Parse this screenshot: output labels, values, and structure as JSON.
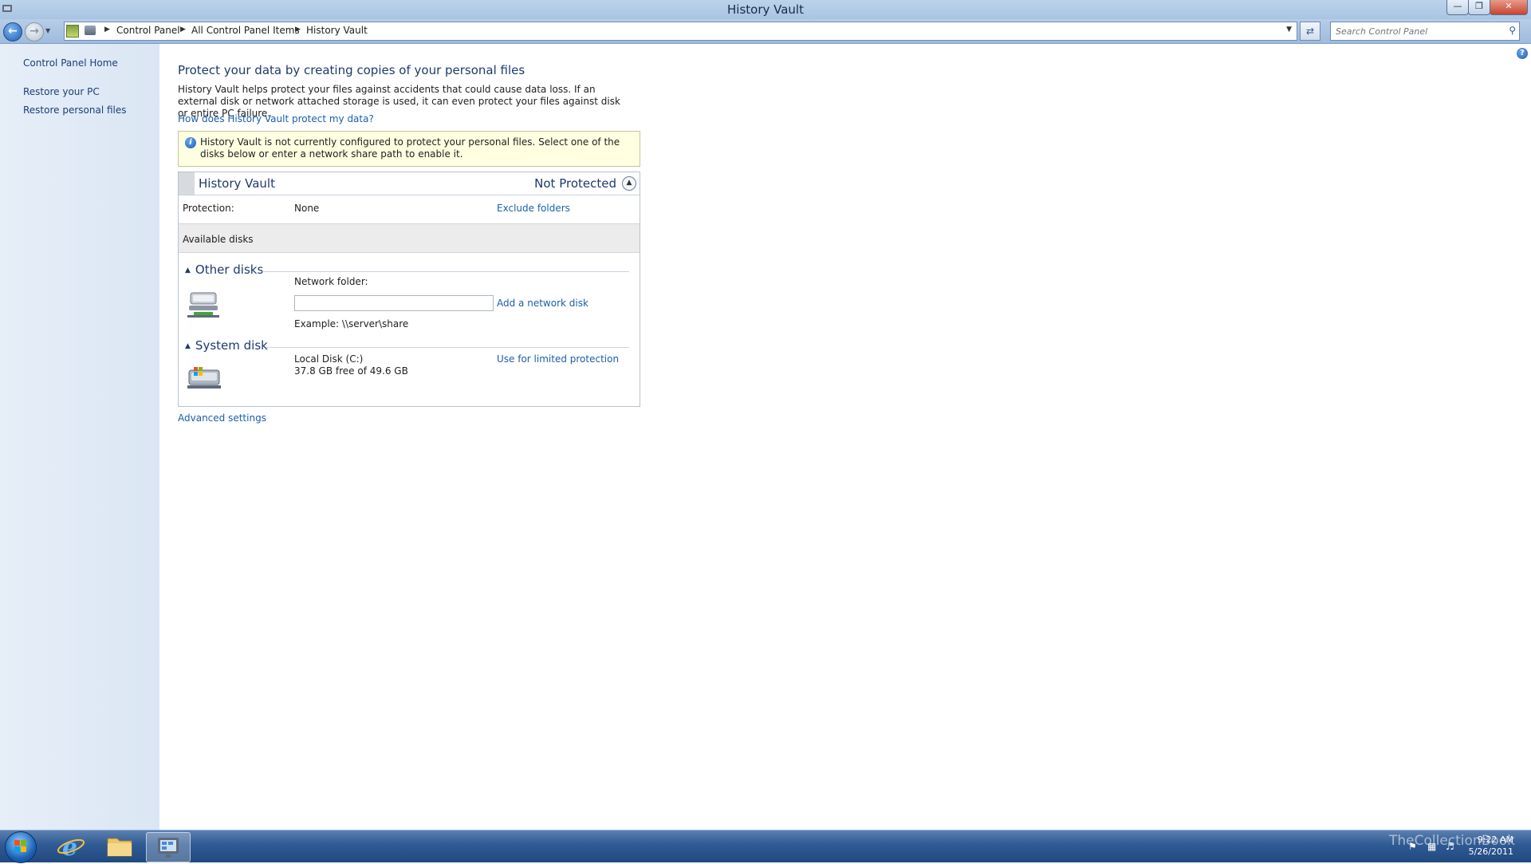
{
  "window": {
    "title": "History Vault"
  },
  "nav": {
    "breadcrumbs": [
      "Control Panel",
      "All Control Panel Items",
      "History Vault"
    ],
    "search_placeholder": "Search Control Panel"
  },
  "sidebar": {
    "items": [
      {
        "label": "Control Panel Home"
      },
      {
        "label": "Restore your PC"
      },
      {
        "label": "Restore personal files"
      }
    ]
  },
  "main": {
    "heading": "Protect your data by creating copies of your personal files",
    "description": "History Vault helps protect your files against accidents that could cause data loss. If an external disk or network attached storage is used, it can even protect your files against disk or entire PC failure.",
    "how_link": "How does History Vault protect my data?",
    "notice": "History Vault is not currently configured to protect your personal files. Select one of the disks below or enter a network share path to enable it.",
    "panel": {
      "name": "History Vault",
      "status": "Not Protected",
      "protection_label": "Protection:",
      "protection_value": "None",
      "exclude_link": "Exclude folders",
      "available_disks": "Available disks",
      "other_disks": {
        "title": "Other disks",
        "network_label": "Network folder:",
        "network_value": "",
        "add_link": "Add a network disk",
        "example": "Example: \\\\server\\share"
      },
      "system_disk": {
        "title": "System disk",
        "disk_name": "Local Disk (C:)",
        "disk_space": "37.8 GB free of 49.6 GB",
        "use_link": "Use for limited protection"
      }
    },
    "advanced_link": "Advanced settings"
  },
  "taskbar": {
    "time": "9:22 AM",
    "date": "5/26/2011",
    "watermark": "TheCollectionBook"
  },
  "colors": {
    "link": "#1b5eab",
    "heading": "#1e3a6c",
    "notice_bg": "#ffffe1",
    "sidebar_bg": "#e6eef8"
  }
}
